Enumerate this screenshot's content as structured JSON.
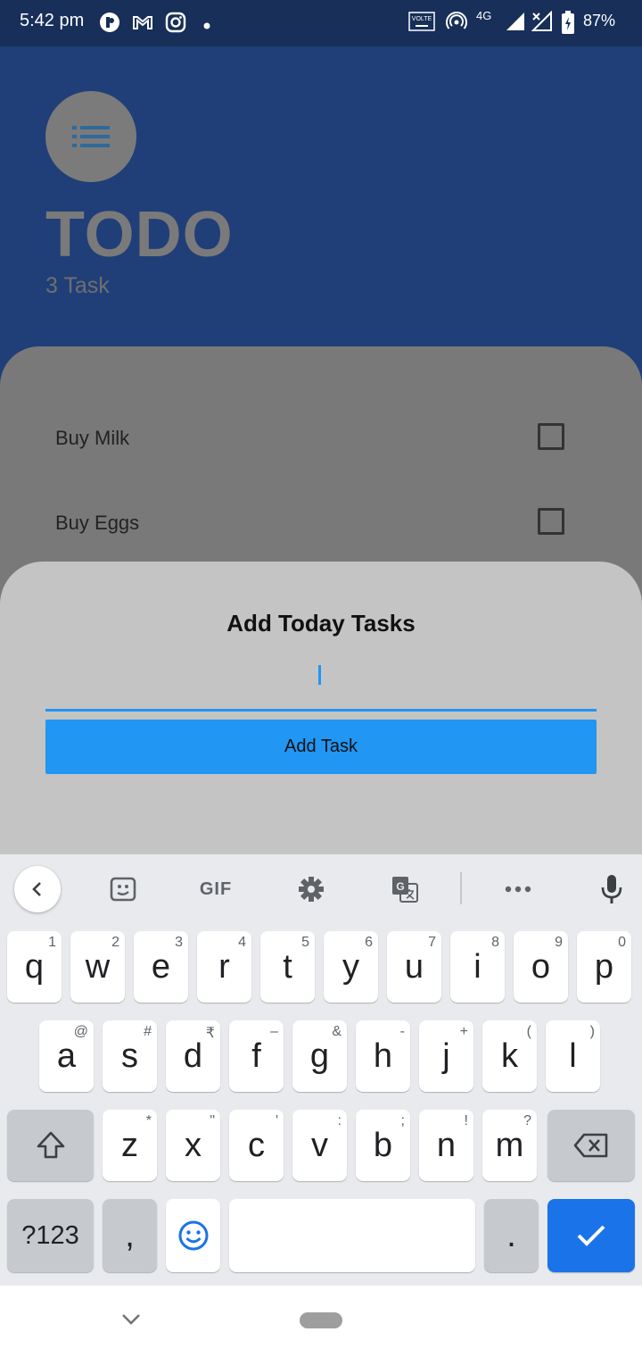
{
  "status_bar": {
    "time": "5:42 pm",
    "volte": "VOLTE",
    "network": "4G",
    "battery": "87%"
  },
  "app": {
    "title": "TODO",
    "task_count": "3 Task",
    "tasks": [
      {
        "label": "Buy Milk",
        "checked": false
      },
      {
        "label": "Buy Eggs",
        "checked": false
      }
    ]
  },
  "sheet": {
    "title": "Add Today Tasks",
    "input_value": "",
    "button_label": "Add Task"
  },
  "keyboard": {
    "toolbar": {
      "gif_label": "GIF"
    },
    "row1": [
      {
        "key": "q",
        "hint": "1"
      },
      {
        "key": "w",
        "hint": "2"
      },
      {
        "key": "e",
        "hint": "3"
      },
      {
        "key": "r",
        "hint": "4"
      },
      {
        "key": "t",
        "hint": "5"
      },
      {
        "key": "y",
        "hint": "6"
      },
      {
        "key": "u",
        "hint": "7"
      },
      {
        "key": "i",
        "hint": "8"
      },
      {
        "key": "o",
        "hint": "9"
      },
      {
        "key": "p",
        "hint": "0"
      }
    ],
    "row2": [
      {
        "key": "a",
        "hint": "@"
      },
      {
        "key": "s",
        "hint": "#"
      },
      {
        "key": "d",
        "hint": "₹"
      },
      {
        "key": "f",
        "hint": "–"
      },
      {
        "key": "g",
        "hint": "&"
      },
      {
        "key": "h",
        "hint": "-"
      },
      {
        "key": "j",
        "hint": "+"
      },
      {
        "key": "k",
        "hint": "("
      },
      {
        "key": "l",
        "hint": ")"
      }
    ],
    "row3": [
      {
        "key": "z",
        "hint": "*"
      },
      {
        "key": "x",
        "hint": "\""
      },
      {
        "key": "c",
        "hint": "'"
      },
      {
        "key": "v",
        "hint": ":"
      },
      {
        "key": "b",
        "hint": ";"
      },
      {
        "key": "n",
        "hint": "!"
      },
      {
        "key": "m",
        "hint": "?"
      }
    ],
    "row4": {
      "symbols": "?123",
      "comma": ",",
      "period": "."
    }
  }
}
